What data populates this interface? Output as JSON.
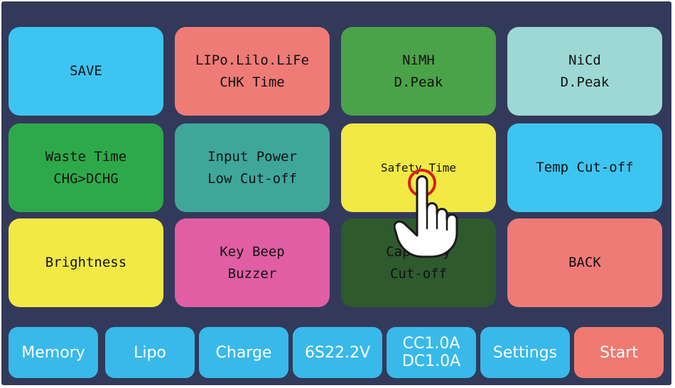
{
  "colors": {
    "background": "#33395a",
    "blue": "#3dc5f2",
    "salmon": "#ef7b77",
    "green": "#4aa348",
    "pale_teal": "#9dd8d4",
    "dark_green": "#2da94a",
    "teal": "#3fa69a",
    "yellow": "#f2e945",
    "pink": "#e15ea5",
    "forest": "#2e5a2e",
    "bottom_blue": "#38b9ea",
    "bottom_red": "#ef7970"
  },
  "menu": {
    "tiles": [
      {
        "line1": "SAVE",
        "line2": ""
      },
      {
        "line1": "LIPo.Lilo.LiFe",
        "line2": "CHK Time"
      },
      {
        "line1": "NiMH",
        "line2": "D.Peak"
      },
      {
        "line1": "NiCd",
        "line2": "D.Peak"
      },
      {
        "line1": "Waste Time",
        "line2": "CHG>DCHG"
      },
      {
        "line1": "Input Power",
        "line2": "Low Cut-off"
      },
      {
        "line1": "Safety Time",
        "line2": ""
      },
      {
        "line1": "Temp Cut-off",
        "line2": ""
      },
      {
        "line1": "Brightness",
        "line2": ""
      },
      {
        "line1": "Key Beep",
        "line2": "Buzzer"
      },
      {
        "line1": "Capacity",
        "line2": "Cut-off"
      },
      {
        "line1": "BACK",
        "line2": ""
      }
    ]
  },
  "bottom_bar": {
    "memory": "Memory",
    "battery_type": "Lipo",
    "mode": "Charge",
    "cells_voltage": "6S22.2V",
    "charge_current": "CC1.0A",
    "discharge_current": "DC1.0A",
    "settings": "Settings",
    "start": "Start"
  },
  "icons": {
    "touch": "hand-pointer-icon"
  }
}
